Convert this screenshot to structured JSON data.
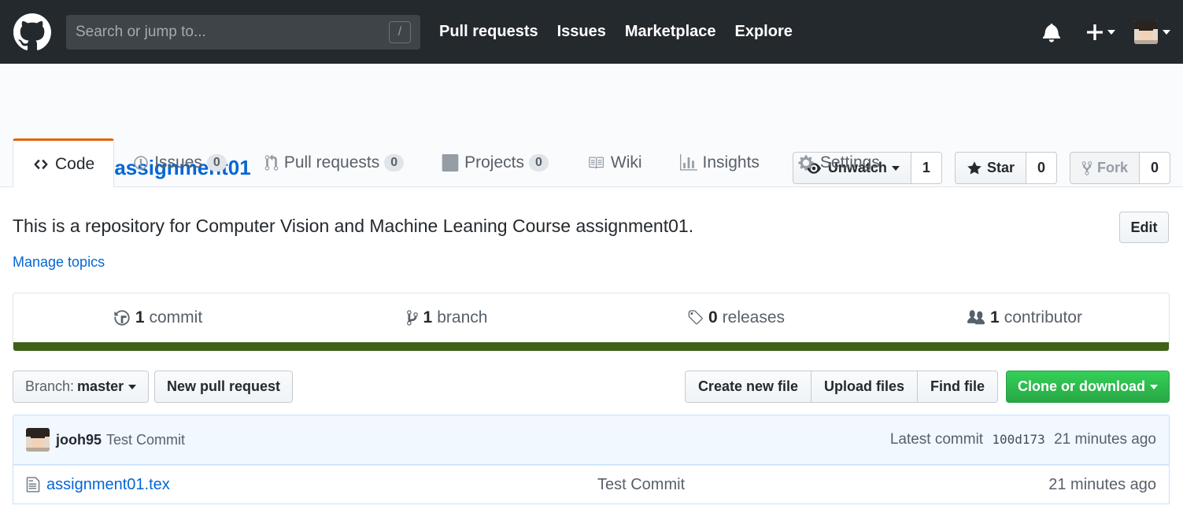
{
  "header": {
    "search_placeholder": "Search or jump to...",
    "search_shortcut": "/",
    "nav": [
      "Pull requests",
      "Issues",
      "Marketplace",
      "Explore"
    ]
  },
  "repo": {
    "owner": "jooh95",
    "separator": "/",
    "name": "assignment01",
    "watch": {
      "label": "Unwatch",
      "count": "1"
    },
    "star": {
      "label": "Star",
      "count": "0"
    },
    "fork": {
      "label": "Fork",
      "count": "0"
    }
  },
  "tabs": [
    {
      "label": "Code",
      "icon": "code-icon",
      "badge": null
    },
    {
      "label": "Issues",
      "icon": "issue-icon",
      "badge": "0"
    },
    {
      "label": "Pull requests",
      "icon": "pull-request-icon",
      "badge": "0"
    },
    {
      "label": "Projects",
      "icon": "project-icon",
      "badge": "0"
    },
    {
      "label": "Wiki",
      "icon": "book-icon",
      "badge": null
    },
    {
      "label": "Insights",
      "icon": "graph-icon",
      "badge": null
    },
    {
      "label": "Settings",
      "icon": "gear-icon",
      "badge": null
    }
  ],
  "description": {
    "text": "This is a repository for Computer Vision and Machine Leaning Course assignment01.",
    "manage_topics": "Manage topics",
    "edit_label": "Edit"
  },
  "summary": {
    "commits": {
      "num": "1",
      "label": "commit"
    },
    "branches": {
      "num": "1",
      "label": "branch"
    },
    "releases": {
      "num": "0",
      "label": "releases"
    },
    "contributors": {
      "num": "1",
      "label": "contributor"
    },
    "language_color": "#3d6117"
  },
  "filenav": {
    "branch_prefix": "Branch:",
    "branch": "master",
    "new_pr": "New pull request",
    "create_file": "Create new file",
    "upload_files": "Upload files",
    "find_file": "Find file",
    "clone": "Clone or download"
  },
  "latest_commit": {
    "author": "jooh95",
    "message": "Test Commit",
    "prefix": "Latest commit",
    "sha": "100d173",
    "age": "21 minutes ago"
  },
  "files": [
    {
      "name": "assignment01.tex",
      "message": "Test Commit",
      "age": "21 minutes ago"
    }
  ],
  "colors": {
    "header_bg": "#24292e",
    "link": "#0366d6",
    "tab_accent": "#e36209",
    "clone_green": "#28a745"
  }
}
